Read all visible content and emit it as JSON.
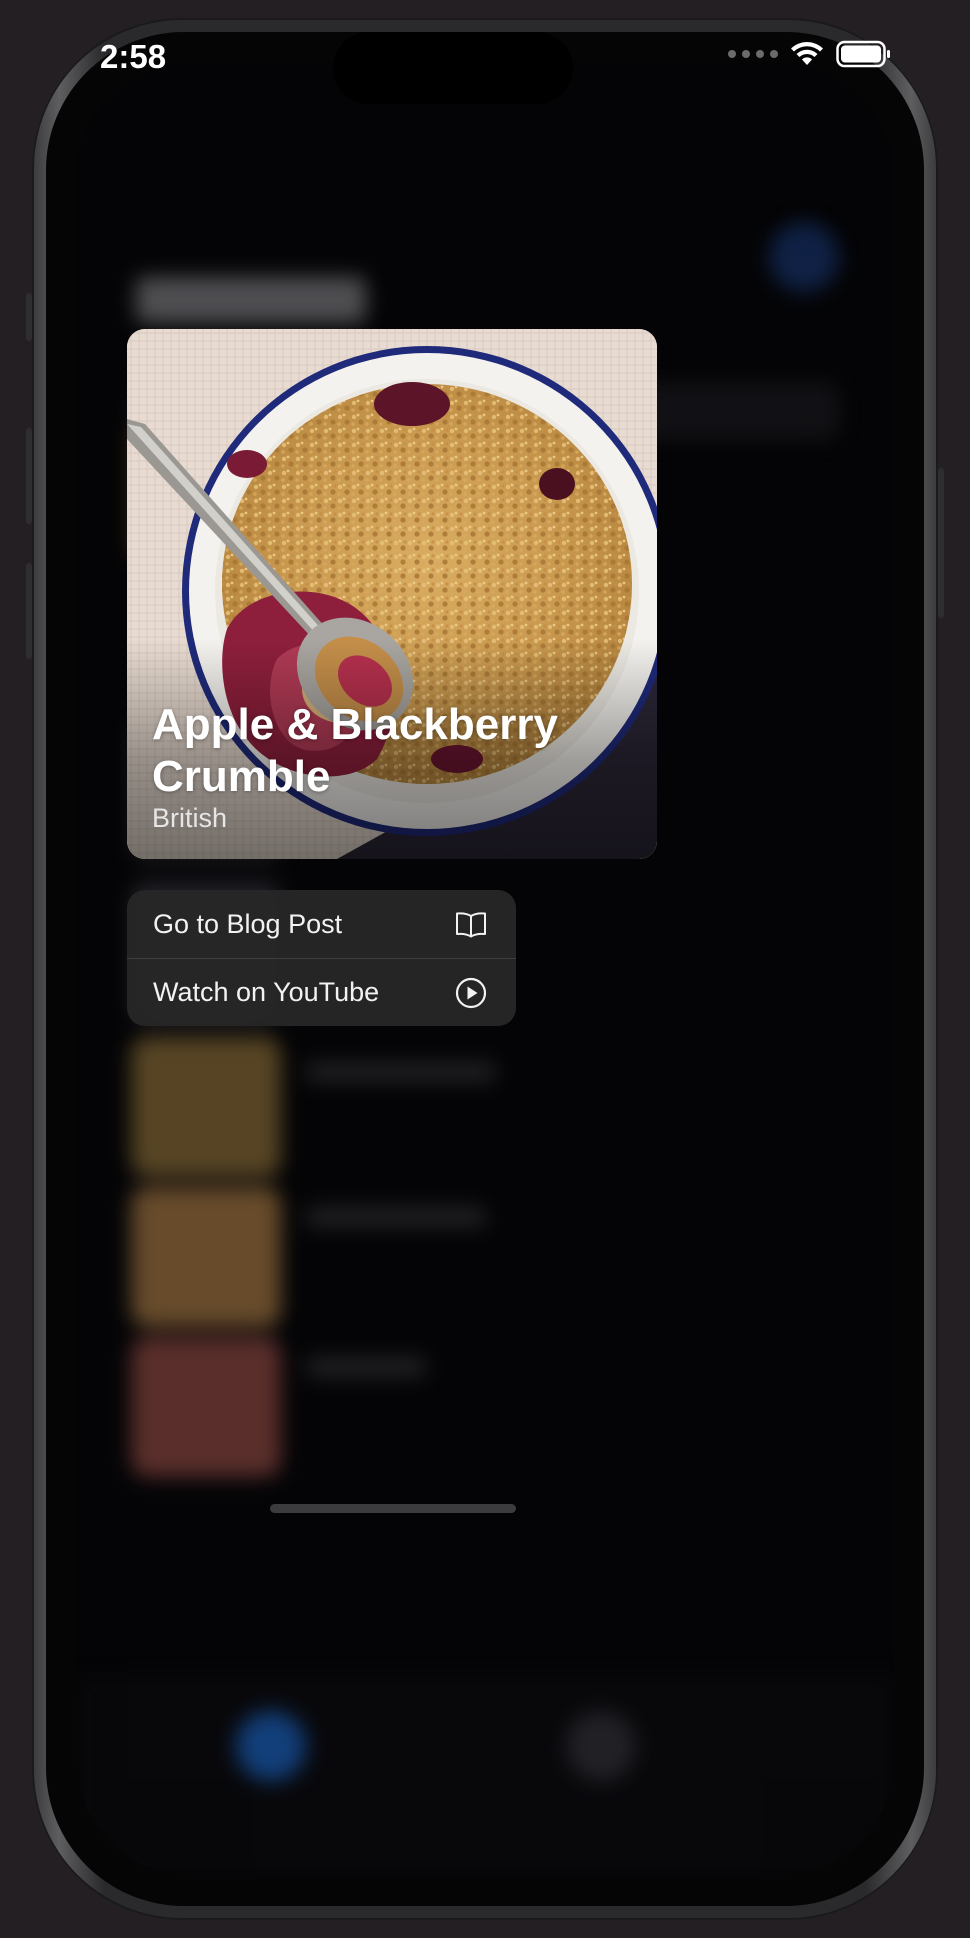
{
  "status_bar": {
    "time": "2:58"
  },
  "recipe_preview": {
    "title": "Apple & Blackberry Crumble",
    "cuisine": "British"
  },
  "context_menu": {
    "items": [
      {
        "label": "Go to Blog Post",
        "icon": "book-icon"
      },
      {
        "label": "Watch on YouTube",
        "icon": "play-circle-icon"
      }
    ]
  },
  "colors": {
    "background": "#231f22",
    "screen": "#040406",
    "menu": "#262628",
    "accent_blue": "#1a3a7a"
  }
}
